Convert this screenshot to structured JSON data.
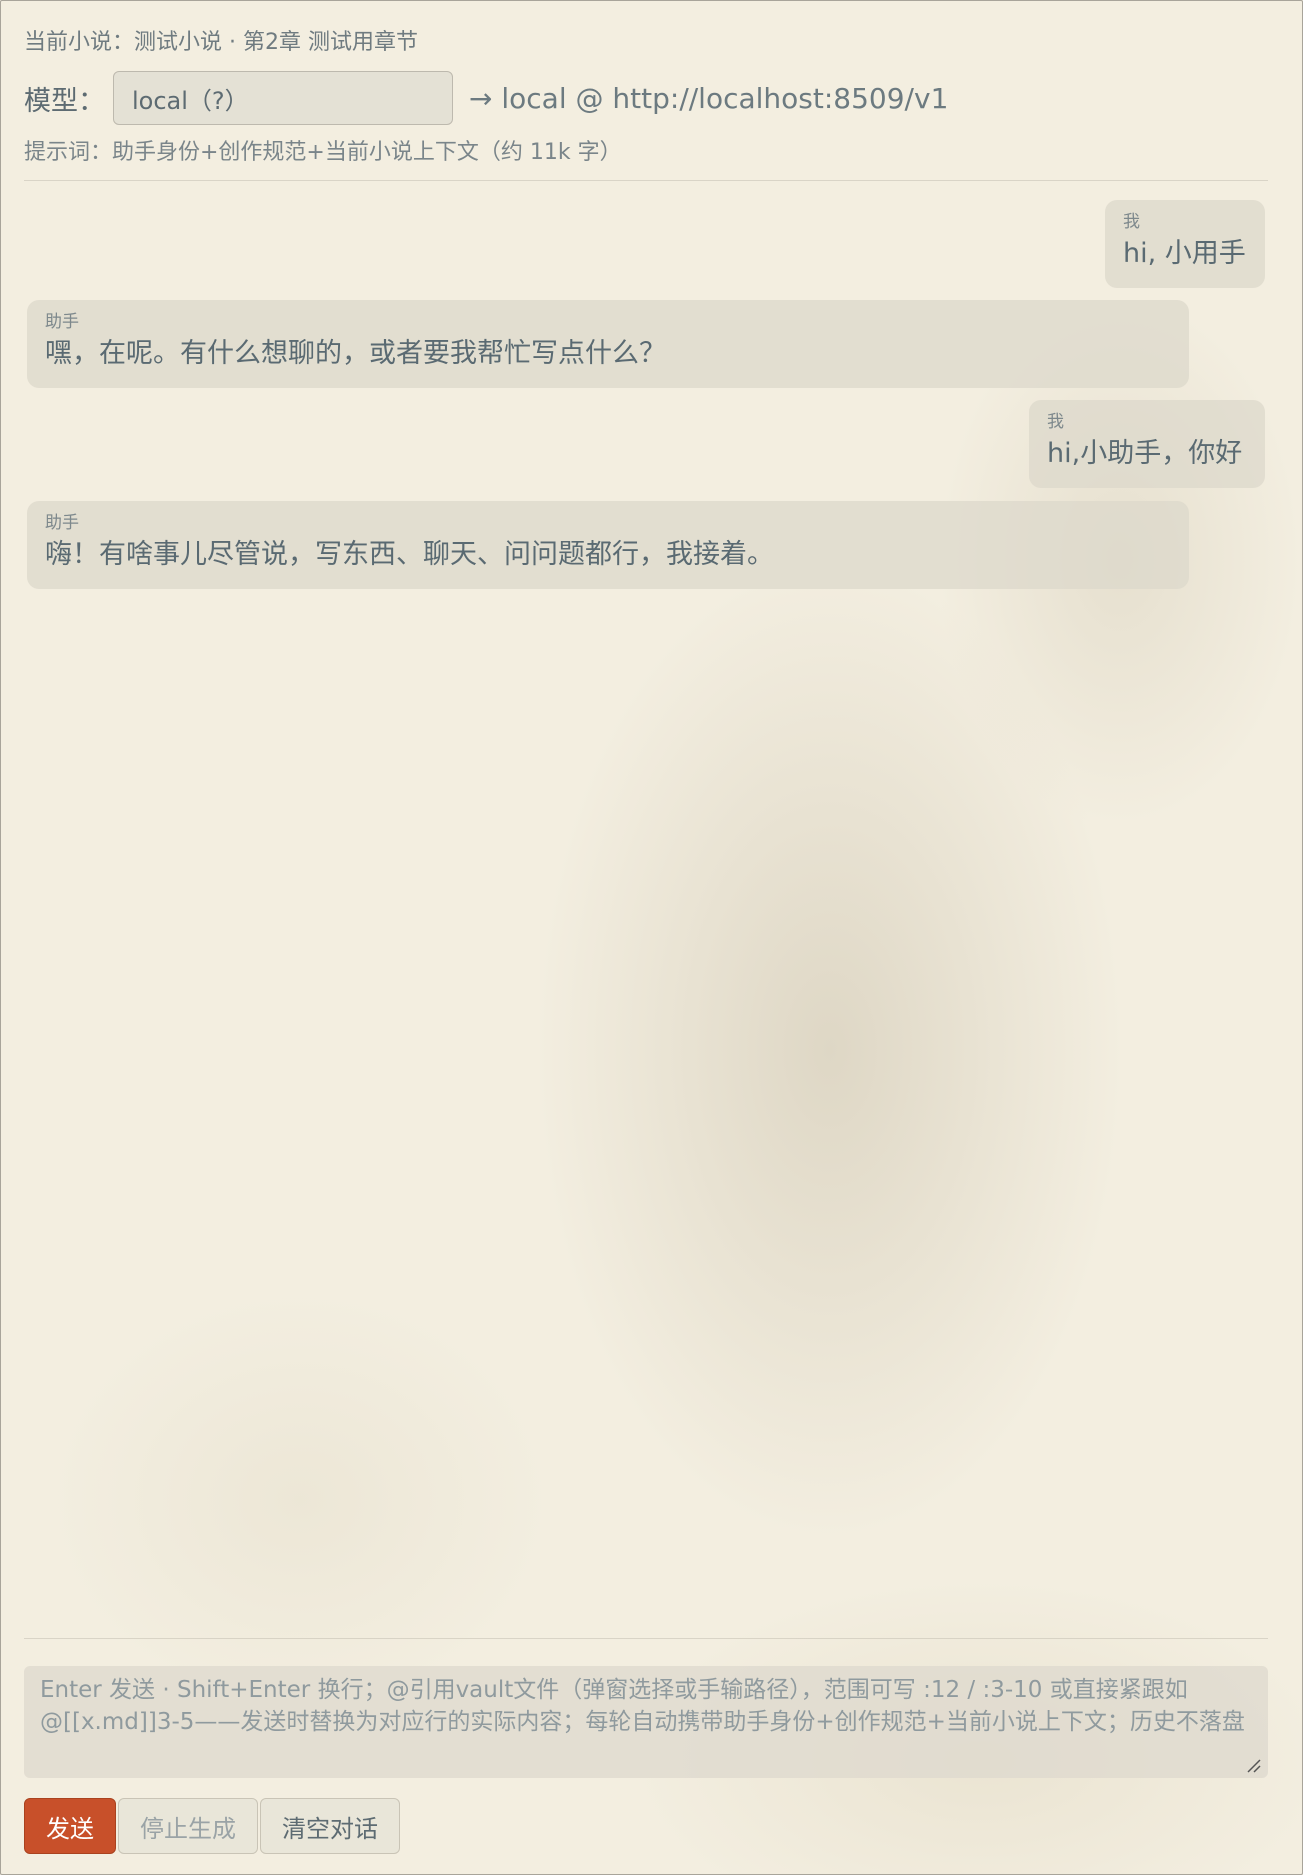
{
  "header": {
    "current_novel": "当前小说：测试小说 · 第2章 测试用章节",
    "model_label": "模型：",
    "model_value": "local（?）",
    "endpoint": "→ local @ http://localhost:8509/v1",
    "prompt_info": "提示词：助手身份+创作规范+当前小说上下文（约 11k 字）"
  },
  "messages": [
    {
      "role": "我",
      "text": "hi, 小用手"
    },
    {
      "role": "助手",
      "text": "嘿，在呢。有什么想聊的，或者要我帮忙写点什么？"
    },
    {
      "role": "我",
      "text": "hi,小助手，你好"
    },
    {
      "role": "助手",
      "text": "嗨！有啥事儿尽管说，写东西、聊天、问问题都行，我接着。"
    }
  ],
  "input": {
    "placeholder": "Enter 发送 · Shift+Enter 换行；@引用vault文件（弹窗选择或手输路径），范围可写 :12 / :3-10 或直接紧跟如 @[[x.md]]3-5——发送时替换为对应行的实际内容；每轮自动携带助手身份+创作规范+当前小说上下文；历史不落盘"
  },
  "buttons": {
    "send": "发送",
    "stop": "停止生成",
    "clear": "清空对话"
  },
  "colors": {
    "background": "#f3eee0",
    "bubble": "#dcd8cb",
    "send_button": "#c8502a"
  }
}
